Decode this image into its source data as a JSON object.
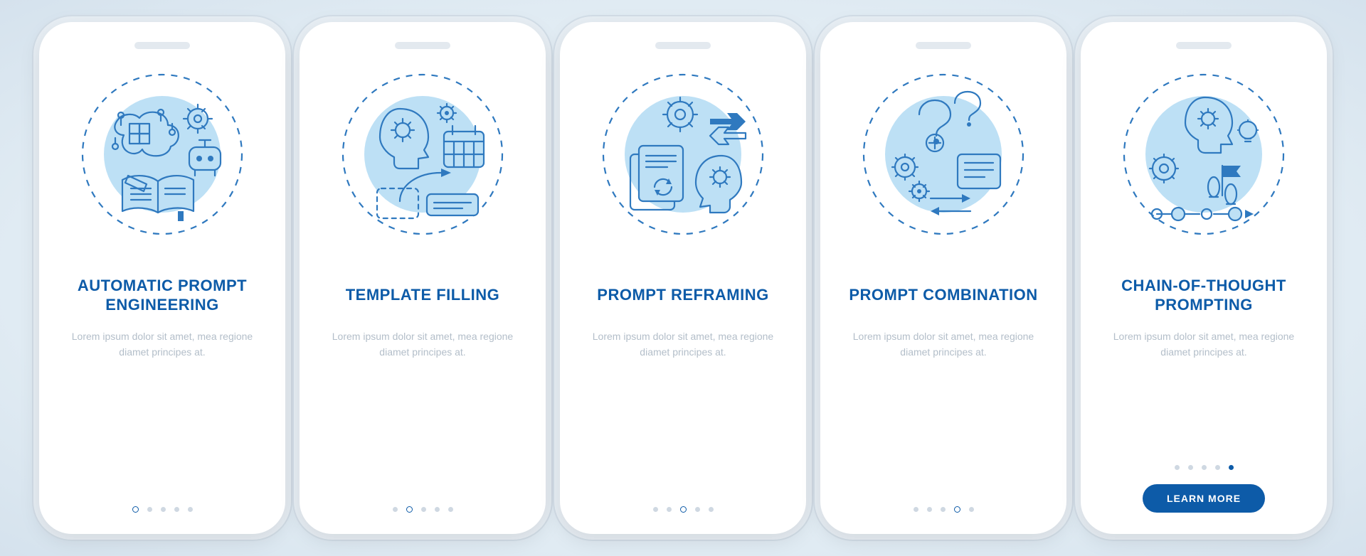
{
  "lorem": "Lorem ipsum dolor sit amet, mea regione diamet principes at.",
  "cta_label": "LEARN MORE",
  "colors": {
    "primary": "#0d5ba8",
    "accent_light": "#bde0f5",
    "text_muted": "#b3bec9"
  },
  "screens": [
    {
      "title": "AUTOMATIC PROMPT ENGINEERING",
      "desc_key": "lorem",
      "active_index": 0,
      "has_cta": false,
      "icon": "auto-prompt-engineering-icon"
    },
    {
      "title": "TEMPLATE FILLING",
      "desc_key": "lorem",
      "active_index": 1,
      "has_cta": false,
      "icon": "template-filling-icon"
    },
    {
      "title": "PROMPT REFRAMING",
      "desc_key": "lorem",
      "active_index": 2,
      "has_cta": false,
      "icon": "prompt-reframing-icon"
    },
    {
      "title": "PROMPT COMBINATION",
      "desc_key": "lorem",
      "active_index": 3,
      "has_cta": false,
      "icon": "prompt-combination-icon"
    },
    {
      "title": "CHAIN-OF-THOUGHT PROMPTING",
      "desc_key": "lorem",
      "active_index": 4,
      "has_cta": true,
      "icon": "chain-of-thought-icon"
    }
  ]
}
